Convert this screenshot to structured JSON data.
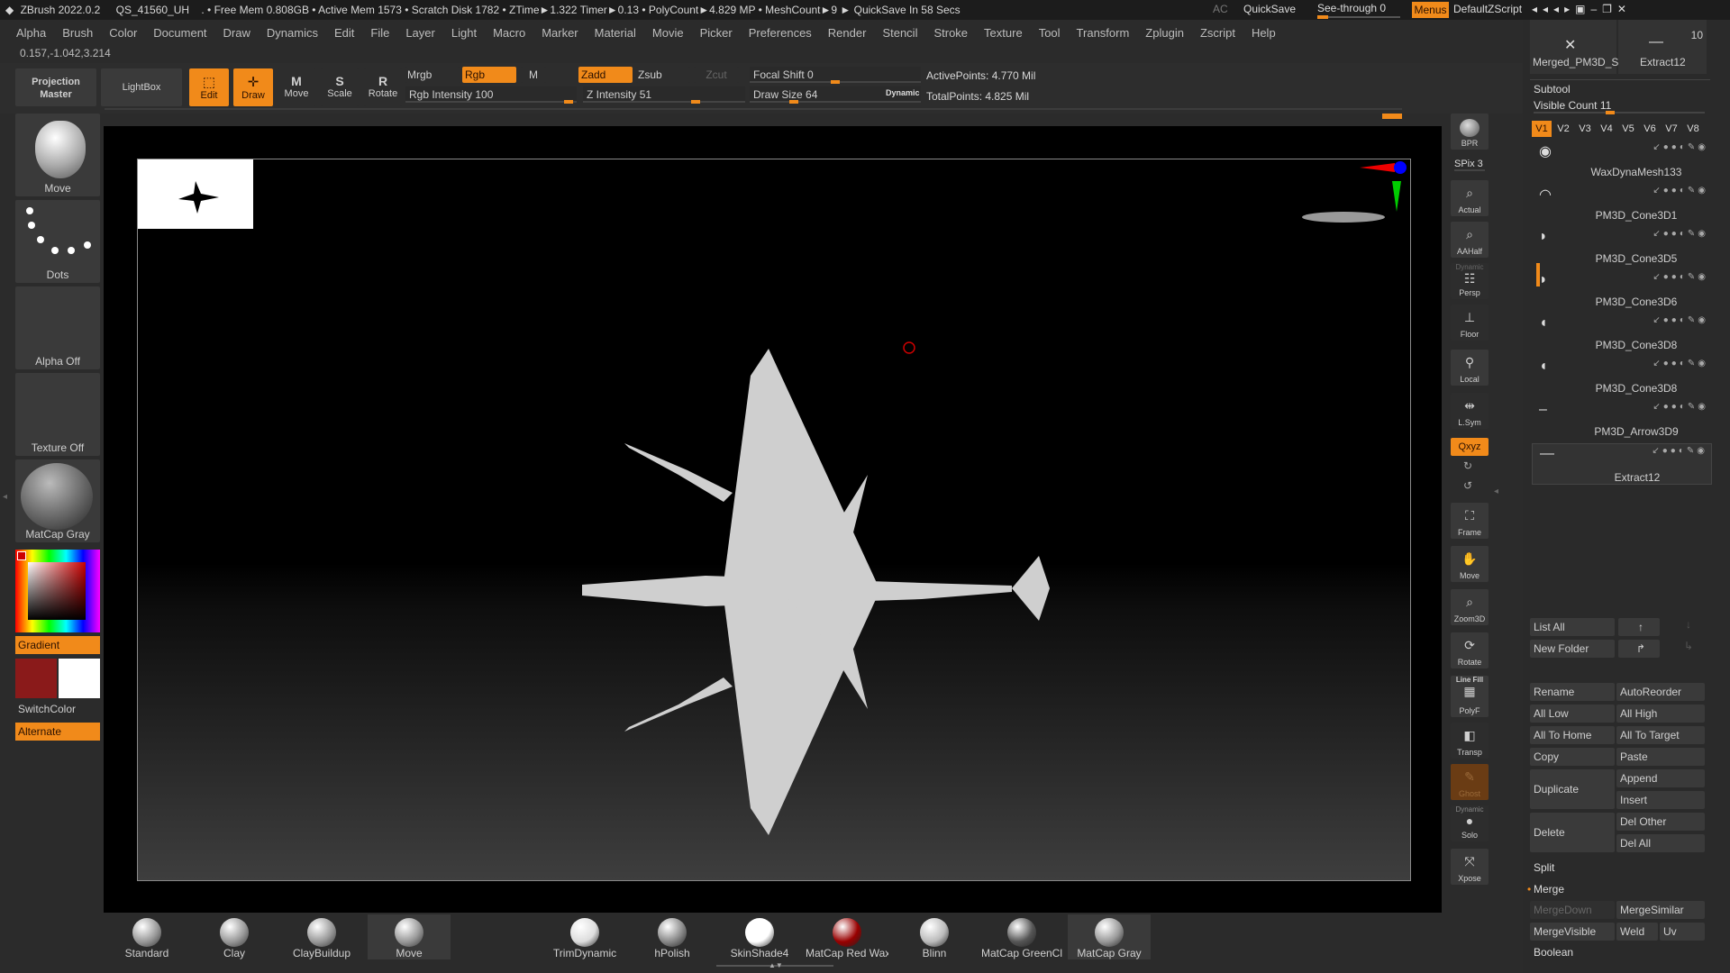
{
  "titlebar": {
    "app": "ZBrush 2022.0.2",
    "doc": "QS_41560_UH",
    "stats": ". • Free Mem 0.808GB • Active Mem 1573 • Scratch Disk 1782 • ZTime►1.322 Timer►0.13 • PolyCount►4.829 MP • MeshCount►9 ► QuickSave In 58 Secs",
    "ac": "AC",
    "quicksave": "QuickSave",
    "seethrough": "See-through 0",
    "menus": "Menus",
    "script": "DefaultZScript"
  },
  "menu": [
    "Alpha",
    "Brush",
    "Color",
    "Document",
    "Draw",
    "Dynamics",
    "Edit",
    "File",
    "Layer",
    "Light",
    "Macro",
    "Marker",
    "Material",
    "Movie",
    "Picker",
    "Preferences",
    "Render",
    "Stencil",
    "Stroke",
    "Texture",
    "Tool",
    "Transform",
    "Zplugin",
    "Zscript",
    "Help"
  ],
  "coords": "0.157,-1.042,3.214",
  "topbar": {
    "projection": "Projection Master",
    "lightbox": "LightBox",
    "edit": "Edit",
    "draw": "Draw",
    "move": "Move",
    "scale": "Scale",
    "rotate": "Rotate",
    "mrgb": "Mrgb",
    "rgb": "Rgb",
    "m": "M",
    "rgb_intensity": "Rgb Intensity 100",
    "zadd": "Zadd",
    "zsub": "Zsub",
    "zcut": "Zcut",
    "z_intensity": "Z Intensity 51",
    "focal": "Focal Shift 0",
    "draw_size": "Draw Size 64",
    "dynamic": "Dynamic",
    "active_points": "ActivePoints: 4.770 Mil",
    "total_points": "TotalPoints: 4.825 Mil"
  },
  "left": {
    "move": "Move",
    "dots": "Dots",
    "alpha": "Alpha Off",
    "texture": "Texture Off",
    "matcap": "MatCap Gray",
    "gradient": "Gradient",
    "switchcolor": "SwitchColor",
    "alternate": "Alternate"
  },
  "rightv": {
    "bpr": "BPR",
    "spix": "SPix 3",
    "actual": "Actual",
    "aahalf": "AAHalf",
    "dynamic": "Dynamic",
    "persp": "Persp",
    "floor": "Floor",
    "local": "Local",
    "lsym": "L.Sym",
    "xyz": "Qxyz",
    "frame": "Frame",
    "move": "Move",
    "zoom3d": "Zoom3D",
    "rotate": "Rotate",
    "linefill": "Line Fill",
    "polyf": "PolyF",
    "transp": "Transp",
    "ghost": "Ghost",
    "dynamic2": "Dynamic",
    "solo": "Solo",
    "xpose": "Xpose"
  },
  "tray": {
    "thumb1": "Merged_PM3D_S",
    "thumb2": "Extract12",
    "thumb_count": "10",
    "subtool": "Subtool",
    "visible_count": "Visible Count 11",
    "tabs": [
      "V1",
      "V2",
      "V3",
      "V4",
      "V5",
      "V6",
      "V7",
      "V8"
    ],
    "subtools": [
      "WaxDynaMesh133",
      "PM3D_Cone3D1",
      "PM3D_Cone3D5",
      "PM3D_Cone3D6",
      "PM3D_Cone3D8",
      "PM3D_Cone3D8",
      "PM3D_Arrow3D9",
      "Extract12"
    ],
    "list_all": "List All",
    "new_folder": "New Folder",
    "rename": "Rename",
    "autoreorder": "AutoReorder",
    "all_low": "All Low",
    "all_high": "All High",
    "all_home": "All To Home",
    "all_target": "All To Target",
    "copy": "Copy",
    "paste": "Paste",
    "duplicate": "Duplicate",
    "append": "Append",
    "insert": "Insert",
    "delete": "Delete",
    "del_other": "Del Other",
    "del_all": "Del All",
    "split": "Split",
    "merge": "Merge",
    "mergedown": "MergeDown",
    "mergesimilar": "MergeSimilar",
    "mergevisible": "MergeVisible",
    "weld": "Weld",
    "uv": "Uv",
    "boolean": "Boolean"
  },
  "brushes": [
    "Standard",
    "Clay",
    "ClayBuildup",
    "Move"
  ],
  "materials": [
    "TrimDynamic",
    "hPolish",
    "SkinShade4",
    "MatCap Red Wax",
    "Blinn",
    "MatCap GreenCl",
    "MatCap Gray"
  ],
  "colors": {
    "accent": "#f18a1a",
    "primary": "#8a1a1a",
    "secondary": "#ffffff"
  }
}
